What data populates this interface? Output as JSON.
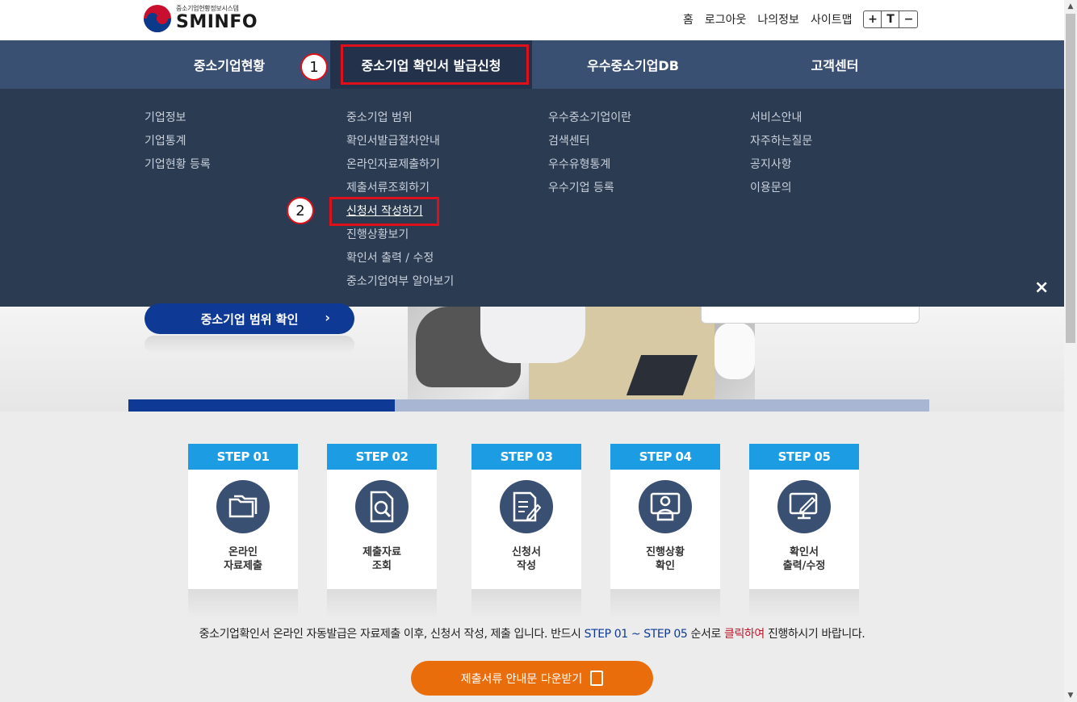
{
  "header": {
    "logo_sub": "중소기업현황정보시스템",
    "logo_main": "SMINFO",
    "util_links": [
      "홈",
      "로그아웃",
      "나의정보",
      "사이트맵"
    ],
    "font_buttons": [
      "+",
      "T",
      "−"
    ]
  },
  "nav": {
    "items": [
      "중소기업현황",
      "중소기업 확인서 발급신청",
      "우수중소기업DB",
      "고객센터"
    ],
    "active": "중소기업 확인서 발급신청"
  },
  "dropdown": {
    "columns": [
      [
        "기업정보",
        "기업통계",
        "기업현황 등록"
      ],
      [
        "중소기업 범위",
        "확인서발급절차안내",
        "온라인자료제출하기",
        "제출서류조회하기",
        "신청서 작성하기",
        "진행상황보기",
        "확인서 출력 / 수정",
        "중소기업여부 알아보기"
      ],
      [
        "우수중소기업이란",
        "검색센터",
        "우수유형통계",
        "우수기업 등록"
      ],
      [
        "서비스안내",
        "자주하는질문",
        "공지사항",
        "이용문의"
      ]
    ],
    "selected": "신청서 작성하기",
    "close_icon": "×"
  },
  "callouts": {
    "one": "1",
    "two": "2"
  },
  "hero": {
    "button_label": "중소기업 범위 확인",
    "chevron": "›",
    "progress": 0.333
  },
  "steps": [
    {
      "title": "STEP 01",
      "label": "온라인\n자료제출",
      "icon": "folder-icon"
    },
    {
      "title": "STEP 02",
      "label": "제출자료\n조회",
      "icon": "document-search-icon"
    },
    {
      "title": "STEP 03",
      "label": "신청서\n작성",
      "icon": "document-edit-icon"
    },
    {
      "title": "STEP 04",
      "label": "진행상황\n확인",
      "icon": "monitor-person-icon"
    },
    {
      "title": "STEP 05",
      "label": "확인서\n출력/수정",
      "icon": "monitor-pen-icon"
    }
  ],
  "notice": {
    "part1": "중소기업확인서 온라인 자동발급은 자료제출 이후, 신청서 작성, 제출 입니다. 반드시 ",
    "part2": "STEP 01 ~ STEP 05",
    "part3": " 순서로 ",
    "part4": "클릭하여",
    "part5": " 진행하시기 바랍니다."
  },
  "download": {
    "label": "제출서류 안내문 다운받기"
  },
  "colors": {
    "nav": "#3a5072",
    "dropdown": "#2b3b52",
    "step_head": "#1b9ce3",
    "primary": "#0e3a96",
    "orange": "#ea6d0b",
    "callout": "#e0101a"
  }
}
